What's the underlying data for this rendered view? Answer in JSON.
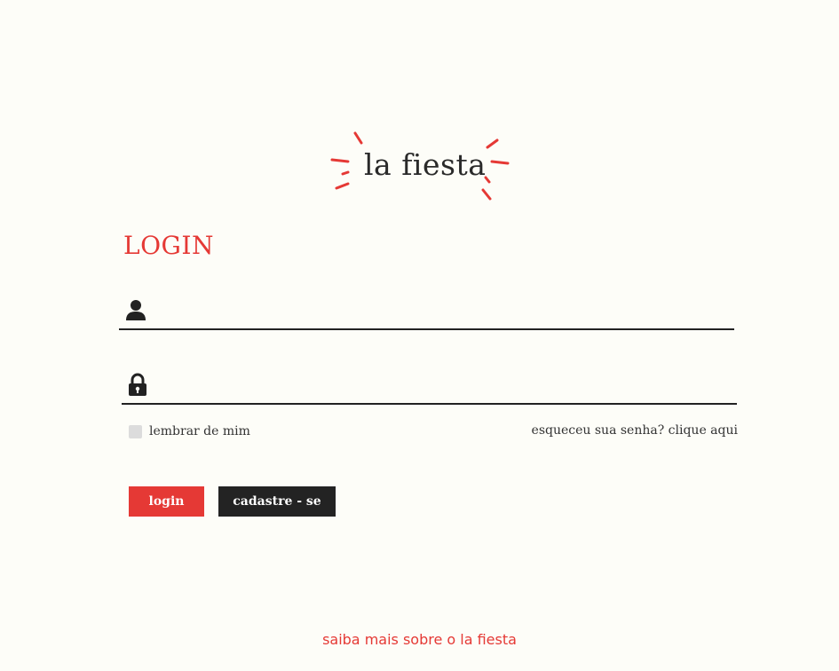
{
  "brand": {
    "name": "la fiesta",
    "accent_color": "#e53935"
  },
  "form": {
    "title": "LOGIN",
    "username": {
      "icon": "user-icon",
      "value": "",
      "placeholder": ""
    },
    "password": {
      "icon": "lock-icon",
      "value": "",
      "placeholder": ""
    },
    "remember_label": "lembrar de mim",
    "remember_checked": false,
    "forgot_label": "esqueceu sua senha? clique aqui",
    "login_button": "login",
    "signup_button": "cadastre - se"
  },
  "footer": {
    "about_link": "saiba mais sobre o la fiesta"
  }
}
